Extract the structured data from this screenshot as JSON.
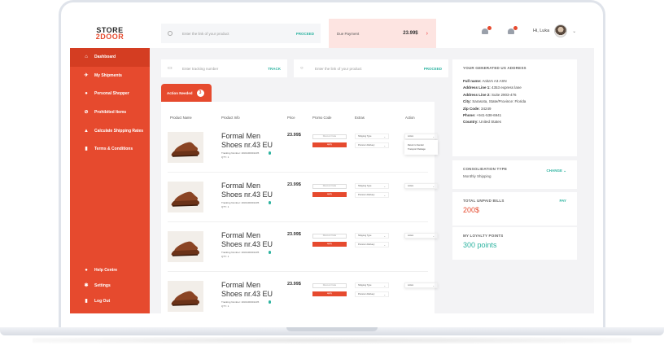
{
  "brand": {
    "line1": "STORE",
    "line2": "2DOOR",
    "colors": {
      "primary": "#e64a2e",
      "accent": "#2db3a0"
    }
  },
  "topbar": {
    "search_placeholder": "Enter the link of your product",
    "search_action": "PROCEED",
    "payment_label": "Due Payment",
    "payment_amount": "23.99$",
    "user_name": "Hi, Luka",
    "notification_icons": [
      "package-icon",
      "bell-icon"
    ]
  },
  "sidebar": {
    "items": [
      {
        "label": "Dashboard",
        "icon": "home-icon"
      },
      {
        "label": "My Shipments",
        "icon": "plane-icon"
      },
      {
        "label": "Personal Shopper",
        "icon": "shopper-icon"
      },
      {
        "label": "Prohibited Items",
        "icon": "ban-icon"
      },
      {
        "label": "Calculate Shipping Rates",
        "icon": "calculator-icon"
      },
      {
        "label": "Terms & Conditions",
        "icon": "document-icon"
      }
    ],
    "bottom": [
      {
        "label": "Help Centre",
        "icon": "help-icon"
      },
      {
        "label": "Settings",
        "icon": "gear-icon"
      },
      {
        "label": "Log Out",
        "icon": "logout-icon"
      }
    ]
  },
  "main": {
    "track_placeholder": "Enter tracking number",
    "track_action": "TRACK",
    "link_placeholder": "Enter the link of your product",
    "link_action": "PROCEED",
    "tab_label": "Action Needed",
    "tab_count": "3",
    "columns": [
      "Product Name",
      "Product Info",
      "Price",
      "Promo Code",
      "Extras",
      "Action"
    ],
    "rows": [
      {
        "name": "Formal Men Shoes nr.43 EU",
        "tracking": "Tracking Number: 2032100301235",
        "qty": "QTY: 1",
        "price": "23.99$",
        "promo_placeholder": "Discount Code",
        "apply": "apply",
        "extra1": "Shipping Type",
        "extra2": "Premium Delivery",
        "action": "Action",
        "menu": [
          "Return to Sender",
          "Transport Package"
        ]
      },
      {
        "name": "Formal Men Shoes nr.43 EU",
        "tracking": "Tracking Number: 2032100301235",
        "qty": "QTY: 1",
        "price": "23.99$",
        "promo_placeholder": "Discount Code",
        "apply": "apply",
        "extra1": "Shipping Type",
        "extra2": "Premium Delivery",
        "action": "Action"
      },
      {
        "name": "Formal Men Shoes nr.43 EU",
        "tracking": "Tracking Number: 2032100301235",
        "qty": "QTY: 1",
        "price": "23.99$",
        "promo_placeholder": "Discount Code",
        "apply": "apply",
        "extra1": "Shipping Type",
        "extra2": "Premium Delivery",
        "action": "Action"
      },
      {
        "name": "Formal Men Shoes nr.43 EU",
        "tracking": "Tracking Number: 2032100301235",
        "qty": "QTY: 1",
        "price": "23.99$",
        "promo_placeholder": "Discount Code",
        "apply": "apply",
        "extra1": "Shipping Type",
        "extra2": "Premium Delivery",
        "action": "Action"
      }
    ]
  },
  "right": {
    "address_title": "YOUR GENERATED US ADDRESS",
    "address": [
      {
        "k": "Full name:",
        "v": "Anita's A3 ASN"
      },
      {
        "k": "Address Line 1:",
        "v": "4353 express lane"
      },
      {
        "k": "Address Line 2:",
        "v": "Suite 2903-476"
      },
      {
        "k": "City:",
        "v": "Sarasota, State/Province: Florida"
      },
      {
        "k": "Zip Code:",
        "v": "34249"
      },
      {
        "k": "Phone:",
        "v": "+941-538-6941"
      },
      {
        "k": "Country:",
        "v": "United States"
      }
    ],
    "consolidation_title": "CONSOLIDATION TYPE",
    "consolidation_value": "Monthly Shipping",
    "change_label": "CHANGE",
    "unpaid_title": "TOTAL UNPAID BILLS",
    "unpaid_value": "200$",
    "pay_label": "PAY",
    "loyalty_title": "MY LOYALTY POINTS",
    "loyalty_value": "300 points"
  }
}
